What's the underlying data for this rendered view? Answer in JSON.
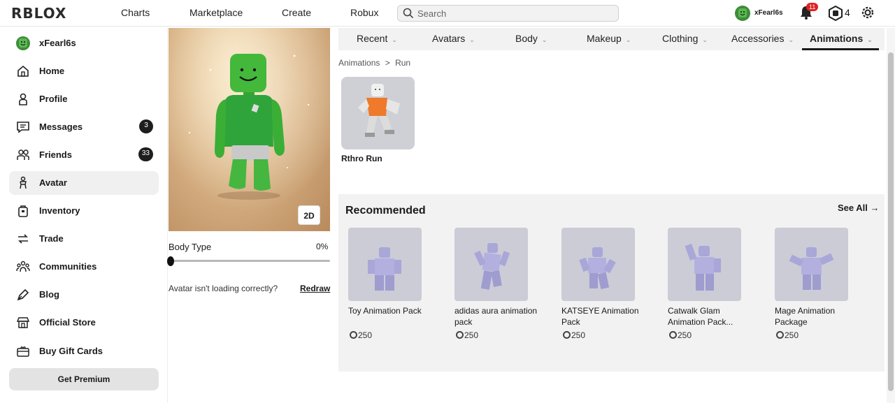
{
  "topbar": {
    "logo": "RBLOX",
    "nav": [
      "Charts",
      "Marketplace",
      "Create",
      "Robux"
    ],
    "search_placeholder": "Search",
    "username": "xFearl6s",
    "notifications": "11",
    "robux": "4"
  },
  "sidebar": {
    "username": "xFearl6s",
    "items": [
      {
        "label": "Home",
        "icon": "home-icon"
      },
      {
        "label": "Profile",
        "icon": "profile-icon"
      },
      {
        "label": "Messages",
        "icon": "messages-icon",
        "count": "3"
      },
      {
        "label": "Friends",
        "icon": "friends-icon",
        "count": "33"
      },
      {
        "label": "Avatar",
        "icon": "avatar-icon"
      },
      {
        "label": "Inventory",
        "icon": "inventory-icon"
      },
      {
        "label": "Trade",
        "icon": "trade-icon"
      },
      {
        "label": "Communities",
        "icon": "communities-icon"
      },
      {
        "label": "Blog",
        "icon": "blog-icon"
      },
      {
        "label": "Official Store",
        "icon": "store-icon"
      },
      {
        "label": "Buy Gift Cards",
        "icon": "gift-card-icon"
      }
    ],
    "premium": "Get Premium"
  },
  "avatar": {
    "toggle_2d": "2D",
    "body_type_label": "Body Type",
    "body_type_value": "0%",
    "body_type_fraction": 0,
    "loading_text": "Avatar isn't loading correctly?",
    "redraw": "Redraw"
  },
  "tabs": [
    "Recent",
    "Avatars",
    "Body",
    "Makeup",
    "Clothing",
    "Accessories",
    "Animations"
  ],
  "active_tab": "Animations",
  "breadcrumb": {
    "parent": "Animations",
    "sep": ">",
    "current": "Run"
  },
  "items": [
    {
      "name": "Rthro Run"
    }
  ],
  "recommended": {
    "title": "Recommended",
    "see_all": "See All →",
    "items": [
      {
        "name": "Toy Animation Pack",
        "price": "250"
      },
      {
        "name": "adidas aura animation pack",
        "price": "250"
      },
      {
        "name": "KATSEYE Animation Pack",
        "price": "250"
      },
      {
        "name": "Catwalk Glam Animation Pack...",
        "price": "250"
      },
      {
        "name": "Mage Animation Package",
        "price": "250"
      }
    ]
  }
}
